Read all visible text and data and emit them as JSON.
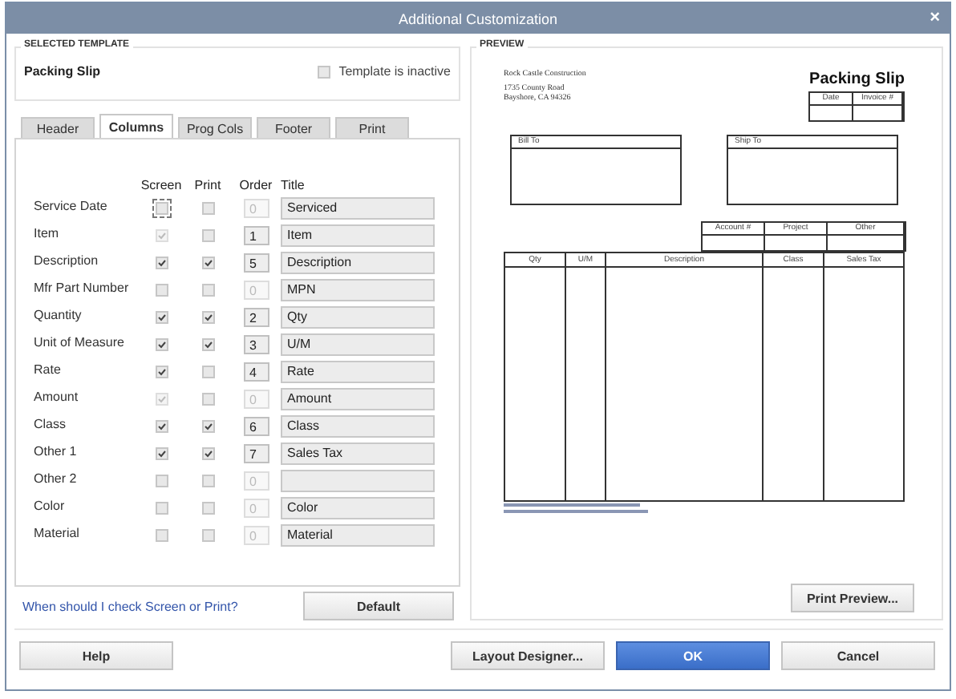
{
  "window": {
    "title": "Additional Customization",
    "close": "×"
  },
  "selected_template": {
    "label": "SELECTED TEMPLATE",
    "name": "Packing Slip",
    "inactive_label": "Template is inactive",
    "inactive_checked": false
  },
  "tabs": [
    {
      "label": "Header",
      "selected": false
    },
    {
      "label": "Columns",
      "selected": true
    },
    {
      "label": "Prog Cols",
      "selected": false
    },
    {
      "label": "Footer",
      "selected": false
    },
    {
      "label": "Print",
      "selected": false
    }
  ],
  "columns": {
    "headers": [
      "Screen",
      "Print",
      "Order",
      "Title"
    ],
    "rows": [
      {
        "name": "Service Date",
        "screen": false,
        "screen_disabled": false,
        "focused": true,
        "print": false,
        "order": "0",
        "order_disabled": true,
        "title": "Serviced"
      },
      {
        "name": "Item",
        "screen": true,
        "screen_disabled": true,
        "focused": false,
        "print": false,
        "order": "1",
        "order_disabled": false,
        "title": "Item"
      },
      {
        "name": "Description",
        "screen": true,
        "screen_disabled": false,
        "focused": false,
        "print": true,
        "order": "5",
        "order_disabled": false,
        "title": "Description"
      },
      {
        "name": "Mfr Part Number",
        "screen": false,
        "screen_disabled": false,
        "focused": false,
        "print": false,
        "order": "0",
        "order_disabled": true,
        "title": "MPN"
      },
      {
        "name": "Quantity",
        "screen": true,
        "screen_disabled": false,
        "focused": false,
        "print": true,
        "order": "2",
        "order_disabled": false,
        "title": "Qty"
      },
      {
        "name": "Unit of Measure",
        "screen": true,
        "screen_disabled": false,
        "focused": false,
        "print": true,
        "order": "3",
        "order_disabled": false,
        "title": "U/M"
      },
      {
        "name": "Rate",
        "screen": true,
        "screen_disabled": false,
        "focused": false,
        "print": false,
        "order": "4",
        "order_disabled": false,
        "title": "Rate"
      },
      {
        "name": "Amount",
        "screen": true,
        "screen_disabled": true,
        "focused": false,
        "print": false,
        "order": "0",
        "order_disabled": true,
        "title": "Amount"
      },
      {
        "name": "Class",
        "screen": true,
        "screen_disabled": false,
        "focused": false,
        "print": true,
        "order": "6",
        "order_disabled": false,
        "title": "Class"
      },
      {
        "name": "Other 1",
        "screen": true,
        "screen_disabled": false,
        "focused": false,
        "print": true,
        "order": "7",
        "order_disabled": false,
        "title": "Sales Tax"
      },
      {
        "name": "Other 2",
        "screen": false,
        "screen_disabled": false,
        "focused": false,
        "print": false,
        "order": "0",
        "order_disabled": true
      },
      {
        "name": "Color",
        "screen": false,
        "screen_disabled": false,
        "focused": false,
        "print": false,
        "order": "0",
        "order_disabled": true,
        "title": "Color"
      },
      {
        "name": "Material",
        "screen": false,
        "screen_disabled": false,
        "focused": false,
        "print": false,
        "order": "0",
        "order_disabled": true,
        "title": "Material"
      }
    ]
  },
  "help_link": "When should I check Screen or Print?",
  "default_button": "Default",
  "preview": {
    "label": "PREVIEW",
    "company": [
      "Rock Castle Construction",
      "1735 County Road",
      "Bayshore, CA 94326"
    ],
    "doc_title": "Packing Slip",
    "meta_headers": [
      "Date",
      "Invoice #"
    ],
    "bill_to": "Bill To",
    "ship_to": "Ship To",
    "info_headers": [
      "Account #",
      "Project",
      "Other"
    ],
    "item_headers": [
      "Qty",
      "U/M",
      "Description",
      "Class",
      "Sales Tax"
    ],
    "print_preview_button": "Print Preview..."
  },
  "buttons": [
    {
      "label": "Help",
      "kind": "normal"
    },
    {
      "label": "Layout Designer...",
      "kind": "normal"
    },
    {
      "label": "OK",
      "kind": "primary"
    },
    {
      "label": "Cancel",
      "kind": "normal"
    }
  ]
}
